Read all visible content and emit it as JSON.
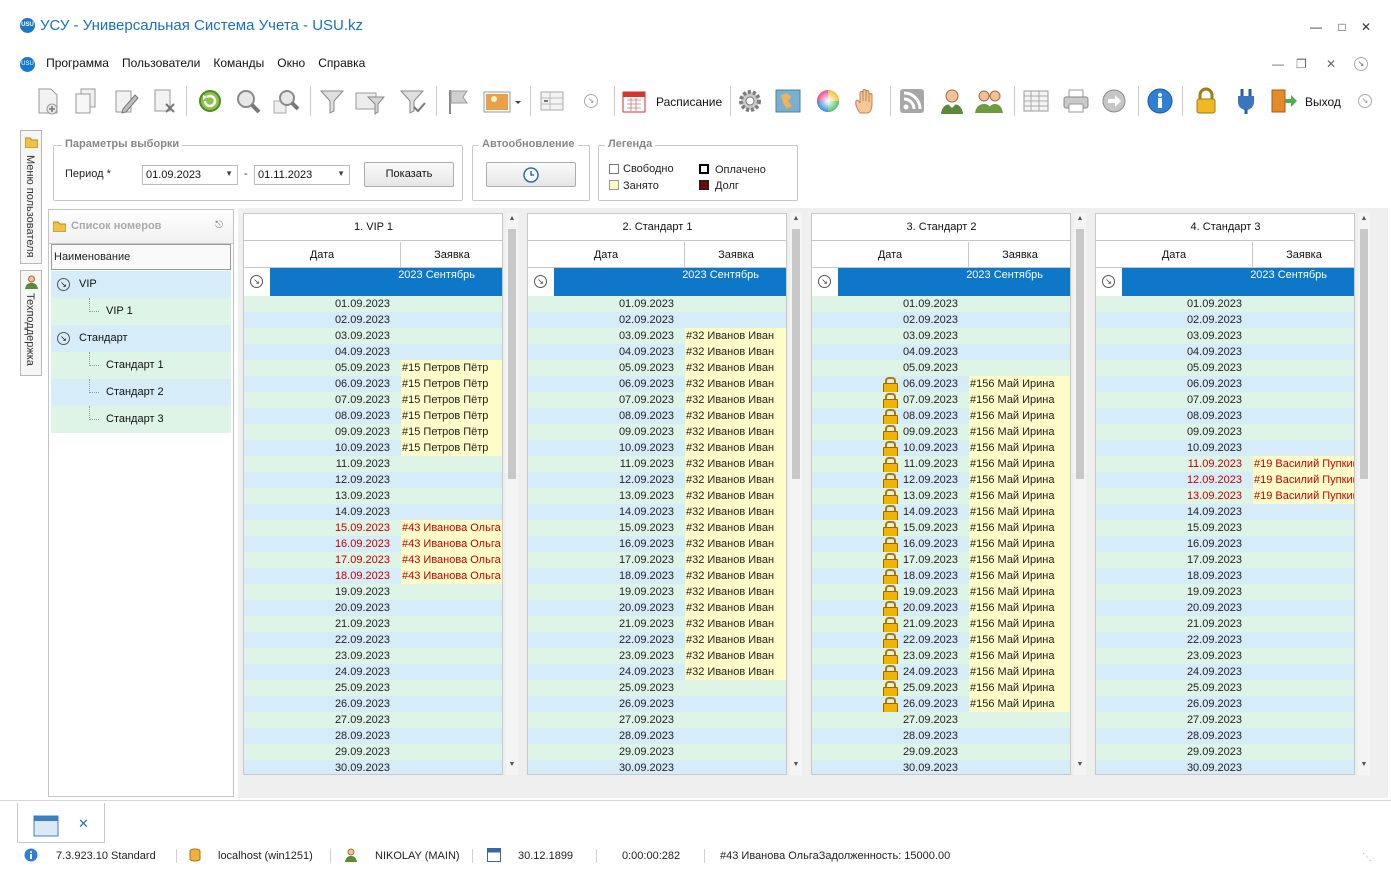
{
  "window": {
    "title": "УСУ - Универсальная Система Учета - USU.kz",
    "logo": "USU"
  },
  "menu": {
    "logo": "USU",
    "items": [
      "Программа",
      "Пользователи",
      "Команды",
      "Окно",
      "Справка"
    ]
  },
  "toolbar": {
    "schedule_label": "Расписание",
    "exit_label": "Выход"
  },
  "sidetabs": {
    "menu": "Меню пользователя",
    "support": "Техподдержка"
  },
  "params": {
    "title": "Параметры выборки",
    "period_label": "Период *",
    "date_from": "01.09.2023",
    "separator": "-",
    "date_to": "01.11.2023",
    "show_button": "Показать"
  },
  "autoupdate": {
    "title": "Автообновление"
  },
  "legend": {
    "title": "Легенда",
    "free": "Свободно",
    "busy": "Занято",
    "paid": "Оплачено",
    "debt": "Долг",
    "colors": {
      "free": "#ffffff",
      "busy": "#fefcc8",
      "paid": "#000000",
      "debt": "#8b0000"
    }
  },
  "roomlist": {
    "title": "Список номеров",
    "column": "Наименование",
    "items": [
      {
        "label": "VIP",
        "level": 0,
        "bg": "#d6ecf9"
      },
      {
        "label": "VIP 1",
        "level": 1,
        "bg": "#ddf4e6"
      },
      {
        "label": "Стандарт",
        "level": 0,
        "bg": "#d6ecf9"
      },
      {
        "label": "Стандарт 1",
        "level": 1,
        "bg": "#ddf4e6"
      },
      {
        "label": "Стандарт 2",
        "level": 1,
        "bg": "#d6ecf9"
      },
      {
        "label": "Стандарт 3",
        "level": 1,
        "bg": "#ddf4e6"
      }
    ]
  },
  "grid": {
    "date_col": "Дата",
    "order_col": "Заявка",
    "group_label": "2023 Сентябрь",
    "row_colors": [
      "#ddf4e6",
      "#d6ecf9"
    ],
    "dates": [
      "01.09.2023",
      "02.09.2023",
      "03.09.2023",
      "04.09.2023",
      "05.09.2023",
      "06.09.2023",
      "07.09.2023",
      "08.09.2023",
      "09.09.2023",
      "10.09.2023",
      "11.09.2023",
      "12.09.2023",
      "13.09.2023",
      "14.09.2023",
      "15.09.2023",
      "16.09.2023",
      "17.09.2023",
      "18.09.2023",
      "19.09.2023",
      "20.09.2023",
      "21.09.2023",
      "22.09.2023",
      "23.09.2023",
      "24.09.2023",
      "25.09.2023",
      "26.09.2023",
      "27.09.2023",
      "28.09.2023",
      "29.09.2023",
      "30.09.2023"
    ]
  },
  "rooms": [
    {
      "title": "1. VIP 1",
      "bookings": [
        {
          "from": 4,
          "to": 9,
          "order": "#15 Петров Пётр",
          "red": false,
          "lock": false
        },
        {
          "from": 14,
          "to": 17,
          "order": "#43 Иванова Ольга",
          "red": true,
          "lock": false
        }
      ]
    },
    {
      "title": "2. Стандарт 1",
      "bookings": [
        {
          "from": 2,
          "to": 23,
          "order": "#32 Иванов Иван",
          "red": false,
          "lock": false
        }
      ]
    },
    {
      "title": "3. Стандарт 2",
      "bookings": [
        {
          "from": 5,
          "to": 25,
          "order": "#156 Май Ирина",
          "red": false,
          "lock": true
        }
      ]
    },
    {
      "title": "4. Стандарт 3",
      "bookings": [
        {
          "from": 10,
          "to": 12,
          "order": "#19 Василий Пупкин",
          "red": true,
          "lock": false
        }
      ]
    }
  ],
  "status": {
    "version": "7.3.923.10 Standard",
    "server": "localhost (win1251)",
    "user": "NIKOLAY (MAIN)",
    "date": "30.12.1899",
    "timer": "0:00:00:282",
    "message": "#43 Иванова ОльгаЗадолженность: 15000.00"
  },
  "icons": [
    "new-record-icon",
    "copy-icon",
    "edit-icon",
    "delete-icon",
    "refresh-icon",
    "search-icon",
    "advanced-search-icon",
    "filter-icon",
    "filter-apply-icon",
    "filter-clear-icon",
    "flag-icon",
    "image-icon",
    "layout-icon",
    "calendar-icon",
    "settings-icon",
    "map-icon",
    "color-wheel-icon",
    "hand-icon",
    "rss-icon",
    "user-icon",
    "users-icon",
    "table-icon",
    "print-icon",
    "arrow-right-icon",
    "info-icon",
    "lock-icon",
    "plug-icon",
    "exit-icon"
  ]
}
